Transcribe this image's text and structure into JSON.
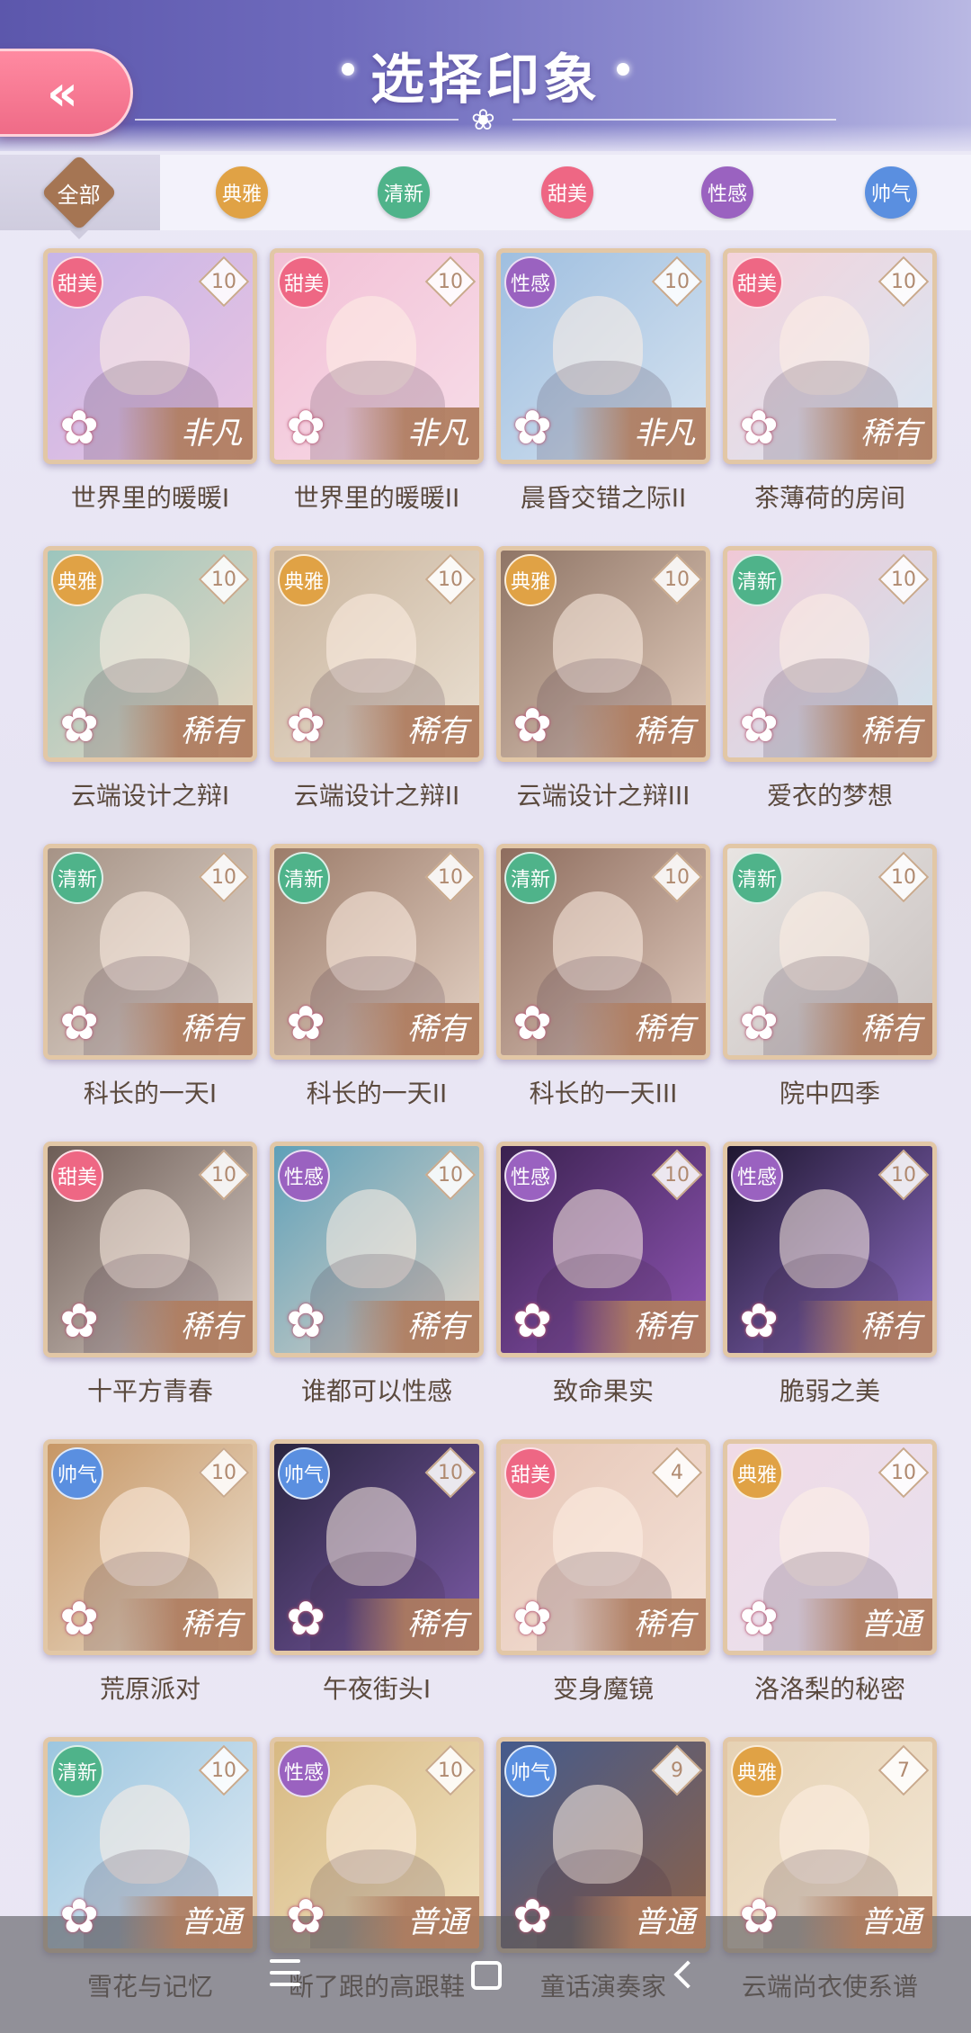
{
  "header": {
    "title": "选择印象",
    "back_label": "«"
  },
  "tabs": [
    {
      "label": "全部",
      "color": "#a57553",
      "active": true
    },
    {
      "label": "典雅",
      "color": "#e0a245",
      "active": false
    },
    {
      "label": "清新",
      "color": "#4fb38a",
      "active": false
    },
    {
      "label": "甜美",
      "color": "#ee6784",
      "active": false
    },
    {
      "label": "性感",
      "color": "#9a62c0",
      "active": false
    },
    {
      "label": "帅气",
      "color": "#5a8fe0",
      "active": false
    }
  ],
  "cards": [
    {
      "tag": "甜美",
      "tag_color": "#ee6784",
      "level": "10",
      "rarity": "非凡",
      "title": "世界里的暖暖I",
      "art": [
        "#c7b5e8",
        "#e9c4e0"
      ]
    },
    {
      "tag": "甜美",
      "tag_color": "#ee6784",
      "level": "10",
      "rarity": "非凡",
      "title": "世界里的暖暖II",
      "art": [
        "#f2c0d6",
        "#f7dde8"
      ]
    },
    {
      "tag": "性感",
      "tag_color": "#9a62c0",
      "level": "10",
      "rarity": "非凡",
      "title": "晨昏交错之际II",
      "art": [
        "#9fbfe0",
        "#d6e3f0"
      ]
    },
    {
      "tag": "甜美",
      "tag_color": "#ee6784",
      "level": "10",
      "rarity": "稀有",
      "title": "茶薄荷的房间",
      "art": [
        "#f4d3dc",
        "#d7e6f2"
      ]
    },
    {
      "tag": "典雅",
      "tag_color": "#e0a245",
      "level": "10",
      "rarity": "稀有",
      "title": "云端设计之辩I",
      "art": [
        "#9cc5bd",
        "#e8d8c2"
      ]
    },
    {
      "tag": "典雅",
      "tag_color": "#e0a245",
      "level": "10",
      "rarity": "稀有",
      "title": "云端设计之辩II",
      "art": [
        "#c8b39c",
        "#ebe1d3"
      ]
    },
    {
      "tag": "典雅",
      "tag_color": "#e0a245",
      "level": "10",
      "rarity": "稀有",
      "title": "云端设计之辩III",
      "art": [
        "#8f7566",
        "#e3cdbd"
      ]
    },
    {
      "tag": "清新",
      "tag_color": "#4fb38a",
      "level": "10",
      "rarity": "稀有",
      "title": "爱衣的梦想",
      "art": [
        "#f0c8d6",
        "#cfe4ee"
      ]
    },
    {
      "tag": "清新",
      "tag_color": "#4fb38a",
      "level": "10",
      "rarity": "稀有",
      "title": "科长的一天I",
      "art": [
        "#a69386",
        "#e4dad2"
      ]
    },
    {
      "tag": "清新",
      "tag_color": "#4fb38a",
      "level": "10",
      "rarity": "稀有",
      "title": "科长的一天II",
      "art": [
        "#9c7c6a",
        "#e5d3c6"
      ]
    },
    {
      "tag": "清新",
      "tag_color": "#4fb38a",
      "level": "10",
      "rarity": "稀有",
      "title": "科长的一天III",
      "art": [
        "#8e6d5e",
        "#e0cabd"
      ]
    },
    {
      "tag": "清新",
      "tag_color": "#4fb38a",
      "level": "10",
      "rarity": "稀有",
      "title": "院中四季",
      "art": [
        "#e8e4e2",
        "#c9c2c0"
      ]
    },
    {
      "tag": "甜美",
      "tag_color": "#ee6784",
      "level": "10",
      "rarity": "稀有",
      "title": "十平方青春",
      "art": [
        "#6d5d56",
        "#d9cdc6"
      ]
    },
    {
      "tag": "性感",
      "tag_color": "#9a62c0",
      "level": "10",
      "rarity": "稀有",
      "title": "谁都可以性感",
      "art": [
        "#5fa0b8",
        "#e5d6c9"
      ]
    },
    {
      "tag": "性感",
      "tag_color": "#9a62c0",
      "level": "10",
      "rarity": "稀有",
      "title": "致命果实",
      "art": [
        "#3a214f",
        "#9156b6"
      ]
    },
    {
      "tag": "性感",
      "tag_color": "#9a62c0",
      "level": "10",
      "rarity": "稀有",
      "title": "脆弱之美",
      "art": [
        "#1e1630",
        "#8e6dc4"
      ]
    },
    {
      "tag": "帅气",
      "tag_color": "#5a8fe0",
      "level": "10",
      "rarity": "稀有",
      "title": "荒原派对",
      "art": [
        "#c79766",
        "#ece0cf"
      ]
    },
    {
      "tag": "帅气",
      "tag_color": "#5a8fe0",
      "level": "10",
      "rarity": "稀有",
      "title": "午夜街头I",
      "art": [
        "#2a2540",
        "#7b5aa6"
      ]
    },
    {
      "tag": "甜美",
      "tag_color": "#ee6784",
      "level": "4",
      "rarity": "稀有",
      "title": "变身魔镜",
      "art": [
        "#e6c6b6",
        "#f4e2d8"
      ]
    },
    {
      "tag": "典雅",
      "tag_color": "#e0a245",
      "level": "10",
      "rarity": "普通",
      "title": "洛洛梨的秘密",
      "art": [
        "#f0dbe6",
        "#e7e0ee"
      ]
    },
    {
      "tag": "清新",
      "tag_color": "#4fb38a",
      "level": "10",
      "rarity": "普通",
      "title": "雪花与记忆",
      "art": [
        "#9cc6df",
        "#dfeaf4"
      ]
    },
    {
      "tag": "性感",
      "tag_color": "#9a62c0",
      "level": "10",
      "rarity": "普通",
      "title": "断了跟的高跟鞋",
      "art": [
        "#d7b982",
        "#f1e3c3"
      ]
    },
    {
      "tag": "帅气",
      "tag_color": "#5a8fe0",
      "level": "9",
      "rarity": "普通",
      "title": "童话演奏家",
      "art": [
        "#445a8c",
        "#8d6248"
      ]
    },
    {
      "tag": "典雅",
      "tag_color": "#e0a245",
      "level": "7",
      "rarity": "普通",
      "title": "云端尚衣使系谱",
      "art": [
        "#e6d2b4",
        "#f3e7d5"
      ]
    }
  ],
  "navbar": {
    "menu_icon": "menu-icon",
    "home_icon": "home-icon",
    "back_icon": "back-icon"
  }
}
